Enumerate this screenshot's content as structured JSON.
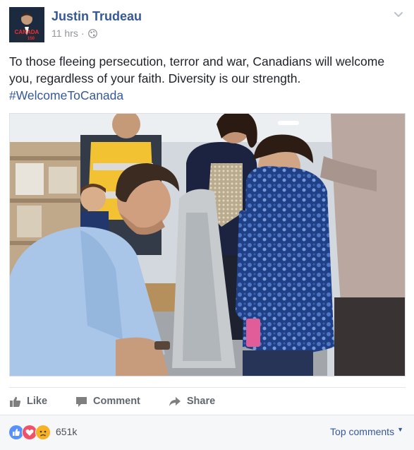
{
  "header": {
    "author_name": "Justin Trudeau",
    "timestamp": "11 hrs",
    "separator": "·",
    "privacy_icon": "globe-icon",
    "menu_icon": "chevron-down-icon",
    "avatar_text_line1": "CANADA",
    "avatar_text_line2": "150"
  },
  "post": {
    "text": "To those fleeing persecution, terror and war, Canadians will welcome you, regardless of your faith. Diversity is our strength.",
    "hashtag": "#WelcomeToCanada"
  },
  "actions": {
    "like_label": "Like",
    "comment_label": "Comment",
    "share_label": "Share"
  },
  "reactions": {
    "icons": [
      "like-icon",
      "love-icon",
      "sad-icon"
    ],
    "count": "651k",
    "top_comments_label": "Top comments"
  },
  "colors": {
    "link_blue": "#365899",
    "muted_text": "#90949c",
    "action_gray": "#616770",
    "like_blue": "#5890ff",
    "love_red": "#f25268",
    "sad_yellow": "#f7b125"
  }
}
